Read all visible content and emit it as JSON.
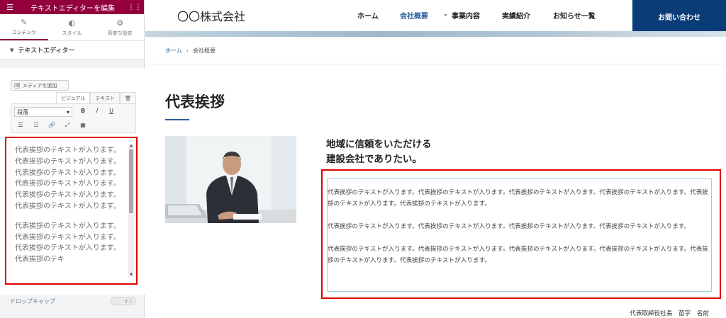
{
  "panel": {
    "header_title": "テキストエディターを編集",
    "tabs": [
      {
        "label": "コンテンツ",
        "icon": "pencil-icon"
      },
      {
        "label": "スタイル",
        "icon": "half-circle-icon"
      },
      {
        "label": "高度な設定",
        "icon": "gear-icon"
      }
    ],
    "section_title": "テキストエディター",
    "add_media": "メディアを追加",
    "mode_tabs": [
      "ビジュアル",
      "テキスト"
    ],
    "format_select": "段落",
    "editor_paragraphs": [
      "代表挨拶のテキストが入ります。代表挨拶のテキストが入ります。代表挨拶のテキストが入ります。代表挨拶のテキストが入ります。代表挨拶のテキストが入ります。代表挨拶のテキストが入ります。",
      "代表挨拶のテキストが入ります。代表挨拶のテキストが入ります。代表挨拶のテキストが入ります。代表挨拶のテキ"
    ],
    "dropcap_label": "ドロップキャップ",
    "dropcap_toggle": "オフ"
  },
  "site": {
    "logo": "〇〇株式会社",
    "nav": [
      "ホーム",
      "会社概要",
      "事業内容",
      "実績紹介",
      "お知らせ一覧"
    ],
    "contact": "お問い合わせ",
    "breadcrumb": [
      "ホーム",
      "会社概要"
    ],
    "page_title": "代表挨拶",
    "heading_line1": "地域に信頼をいただける",
    "heading_line2": "建設会社でありたい。",
    "paragraphs": [
      "代表挨拶のテキストが入ります。代表挨拶のテキストが入ります。代表挨拶のテキストが入ります。代表挨拶のテキストが入ります。代表挨拶のテキストが入ります。代表挨拶のテキストが入ります。",
      "代表挨拶のテキストが入ります。代表挨拶のテキストが入ります。代表挨拶のテキストが入ります。代表挨拶のテキストが入ります。",
      "代表挨拶のテキストが入ります。代表挨拶のテキストが入ります。代表挨拶のテキストが入ります。代表挨拶のテキストが入ります。代表挨拶のテキストが入ります。代表挨拶のテキストが入ります。"
    ],
    "signature": "代表取締役社長　苗字　名前"
  },
  "colors": {
    "panel_header": "#93003c",
    "highlight_border": "#e00000",
    "nav_active": "#2b5f9c",
    "contact_bg": "#0a3d78"
  }
}
